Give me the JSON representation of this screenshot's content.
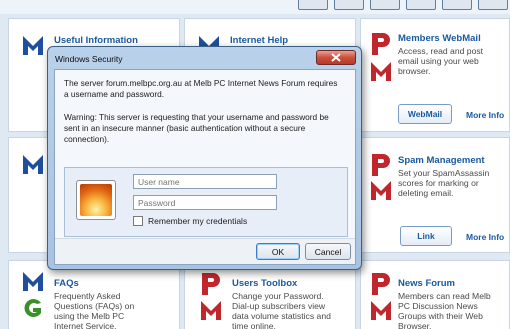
{
  "cards": {
    "useful_information": {
      "title": "Useful Information"
    },
    "internet_help": {
      "title": "Internet Help"
    },
    "members_webmail": {
      "title": "Members WebMail",
      "desc": [
        "Access, read and post",
        "email using your web",
        "browser."
      ],
      "button": "WebMail",
      "more": "More Info"
    },
    "spam_management": {
      "title": "Spam Management",
      "desc": [
        "Set your SpamAssassin",
        "scores for marking or",
        "deleting email."
      ],
      "button": "Link",
      "more": "More Info"
    },
    "faqs": {
      "title": "FAQs",
      "desc": [
        "Frequently Asked",
        "Questions (FAQs) on",
        "using the Melb PC",
        "Internet Service."
      ]
    },
    "users_toolbox": {
      "title": "Users Toolbox",
      "desc": [
        "Change your Password.",
        "Dial-up subscribers view",
        "data volume statistics and",
        "time online."
      ]
    },
    "news_forum": {
      "title": "News Forum",
      "desc": [
        "Members can read Melb",
        "PC Discussion News",
        "Groups with their Web",
        "Browser."
      ]
    }
  },
  "dialog": {
    "title": "Windows Security",
    "message": [
      "The server forum.melbpc.org.au at Melb PC Internet News Forum requires",
      "a username and password."
    ],
    "warning": [
      "Warning: This server is requesting that your username and password be",
      "sent in an insecure manner (basic authentication without a secure",
      "connection)."
    ],
    "username_placeholder": "User name",
    "password_placeholder": "Password",
    "remember_label": "Remember my credentials",
    "ok_label": "OK",
    "cancel_label": "Cancel"
  },
  "colors": {
    "link_blue": "#1a5aa0",
    "logo_red": "#c0272d",
    "logo_blue": "#1e4f9c",
    "logo_green": "#3a8f2a"
  }
}
